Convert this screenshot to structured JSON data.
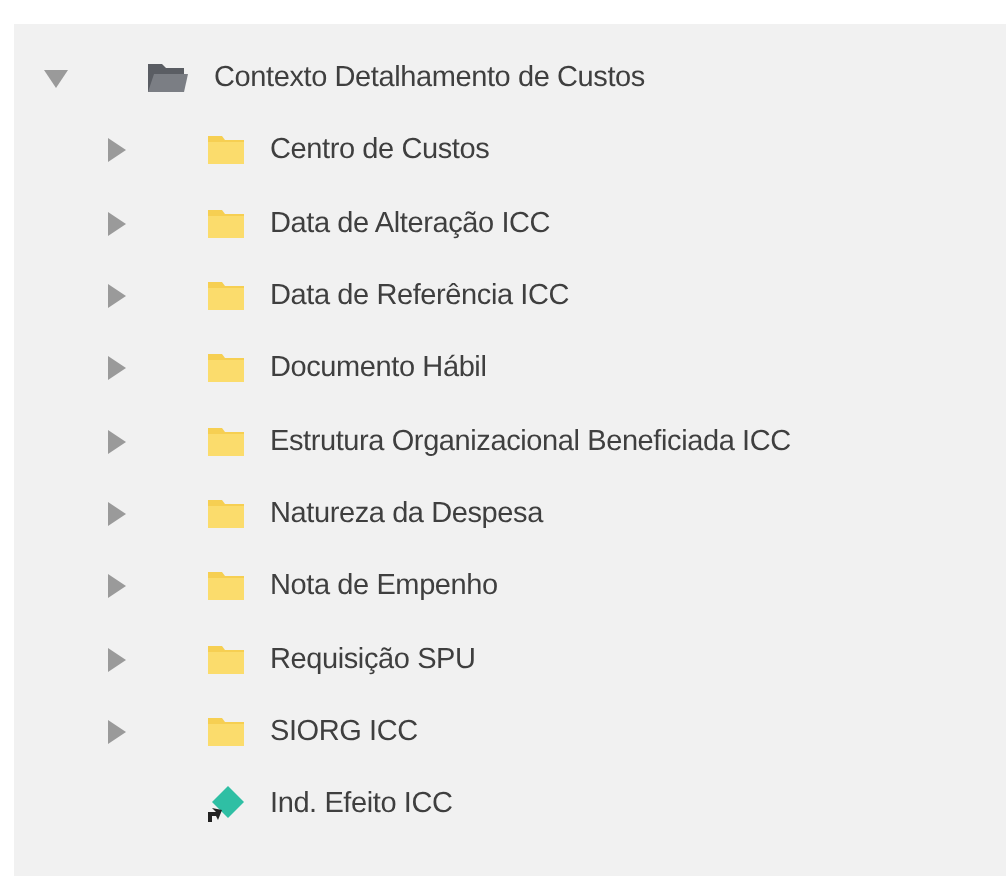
{
  "tree": [
    {
      "label": "Contexto Detalhamento de Custos",
      "kind": "folder",
      "expanded": true,
      "children": [
        {
          "label": "Centro de Custos",
          "kind": "folder",
          "expanded": false
        },
        {
          "label": "Data de Alteração ICC",
          "kind": "folder",
          "expanded": false
        },
        {
          "label": "Data de Referência ICC",
          "kind": "folder",
          "expanded": false
        },
        {
          "label": "Documento Hábil",
          "kind": "folder",
          "expanded": false
        },
        {
          "label": "Estrutura Organizacional Beneficiada ICC",
          "kind": "folder",
          "expanded": false
        },
        {
          "label": "Natureza da Despesa",
          "kind": "folder",
          "expanded": false
        },
        {
          "label": "Nota de Empenho",
          "kind": "folder",
          "expanded": false
        },
        {
          "label": "Requisição SPU",
          "kind": "folder",
          "expanded": false
        },
        {
          "label": "SIORG ICC",
          "kind": "folder",
          "expanded": false
        },
        {
          "label": "Ind. Efeito ICC",
          "kind": "measure"
        }
      ]
    }
  ]
}
